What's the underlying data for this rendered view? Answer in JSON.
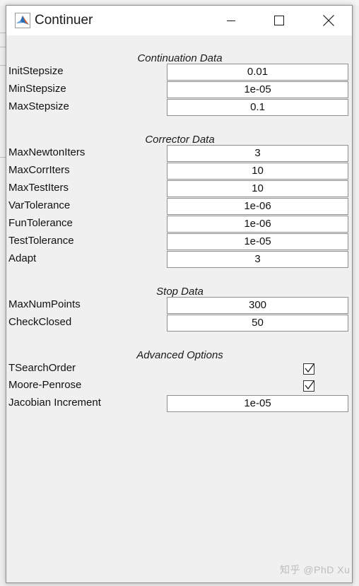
{
  "window": {
    "title": "Continuer"
  },
  "sections": {
    "continuation": "Continuation Data",
    "corrector": "Corrector Data",
    "stop": "Stop Data",
    "advanced": "Advanced Options"
  },
  "continuation": {
    "init_stepsize": {
      "label": "InitStepsize",
      "value": "0.01"
    },
    "min_stepsize": {
      "label": "MinStepsize",
      "value": "1e-05"
    },
    "max_stepsize": {
      "label": "MaxStepsize",
      "value": "0.1"
    }
  },
  "corrector": {
    "max_newton_iters": {
      "label": "MaxNewtonIters",
      "value": "3"
    },
    "max_corr_iters": {
      "label": "MaxCorrIters",
      "value": "10"
    },
    "max_test_iters": {
      "label": "MaxTestIters",
      "value": "10"
    },
    "var_tolerance": {
      "label": "VarTolerance",
      "value": "1e-06"
    },
    "fun_tolerance": {
      "label": "FunTolerance",
      "value": "1e-06"
    },
    "test_tolerance": {
      "label": "TestTolerance",
      "value": "1e-05"
    },
    "adapt": {
      "label": "Adapt",
      "value": "3"
    }
  },
  "stop": {
    "max_num_points": {
      "label": "MaxNumPoints",
      "value": "300"
    },
    "check_closed": {
      "label": "CheckClosed",
      "value": "50"
    }
  },
  "advanced": {
    "tsearch_order": {
      "label": "TSearchOrder",
      "checked": true
    },
    "moore_penrose": {
      "label": "Moore-Penrose",
      "checked": true
    },
    "jacobian_increment": {
      "label": "Jacobian Increment",
      "value": "1e-05"
    }
  },
  "watermark": "知乎 @PhD Xu",
  "colors": {
    "field_border": "#8f8f8f",
    "window_bg": "#f0f0f0",
    "matlab_orange": "#e2612b",
    "matlab_blue": "#2c6fb6"
  },
  "icons": {
    "app": "matlab-logo-icon",
    "minimize": "minimize-icon",
    "maximize": "maximize-icon",
    "close": "close-icon",
    "check": "checkmark-icon"
  }
}
